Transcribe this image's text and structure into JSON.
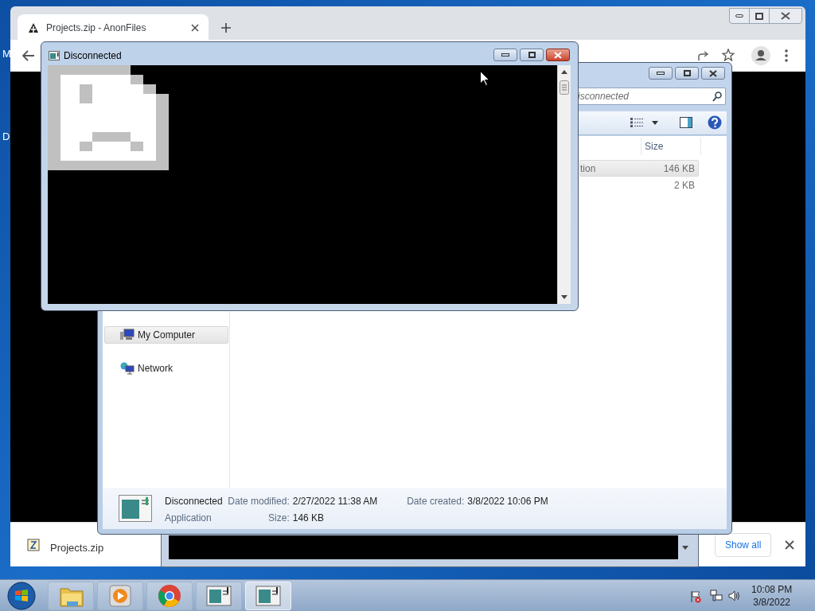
{
  "desktop": {
    "icon_labels": [
      "M",
      "D"
    ]
  },
  "browser": {
    "tab": {
      "title": "Projects.zip - AnonFiles",
      "selected": true
    },
    "download": {
      "filename": "Projects.zip",
      "show_all": "Show all"
    }
  },
  "explorer": {
    "search": {
      "placeholder": "isconnected"
    },
    "columns": [
      "Size"
    ],
    "rows": [
      {
        "column_1": "tion",
        "size": "146 KB",
        "selected": true
      },
      {
        "size": "2 KB",
        "selected": false
      }
    ],
    "nav_items": [
      {
        "label": "My Computer",
        "kind": "computer",
        "selected": true
      },
      {
        "label": "Network",
        "kind": "network",
        "selected": false
      }
    ],
    "details": {
      "name": "Disconnected",
      "type": "Application",
      "fields": [
        {
          "label": "Date modified:",
          "value": "2/27/2022 11:38 AM"
        },
        {
          "label": "Date created:",
          "value": "3/8/2022 10:06 PM"
        },
        {
          "label": "Size:",
          "value": "146 KB"
        }
      ]
    }
  },
  "console": {
    "title": "Disconnected"
  },
  "taskbar": {
    "items": [
      {
        "kind": "folder",
        "selected": false
      },
      {
        "kind": "media",
        "selected": false
      },
      {
        "kind": "chrome",
        "selected": false
      },
      {
        "kind": "console",
        "selected": false
      },
      {
        "kind": "console",
        "selected": true
      }
    ],
    "clock": {
      "time": "10:08 PM",
      "date": "3/8/2022"
    }
  }
}
